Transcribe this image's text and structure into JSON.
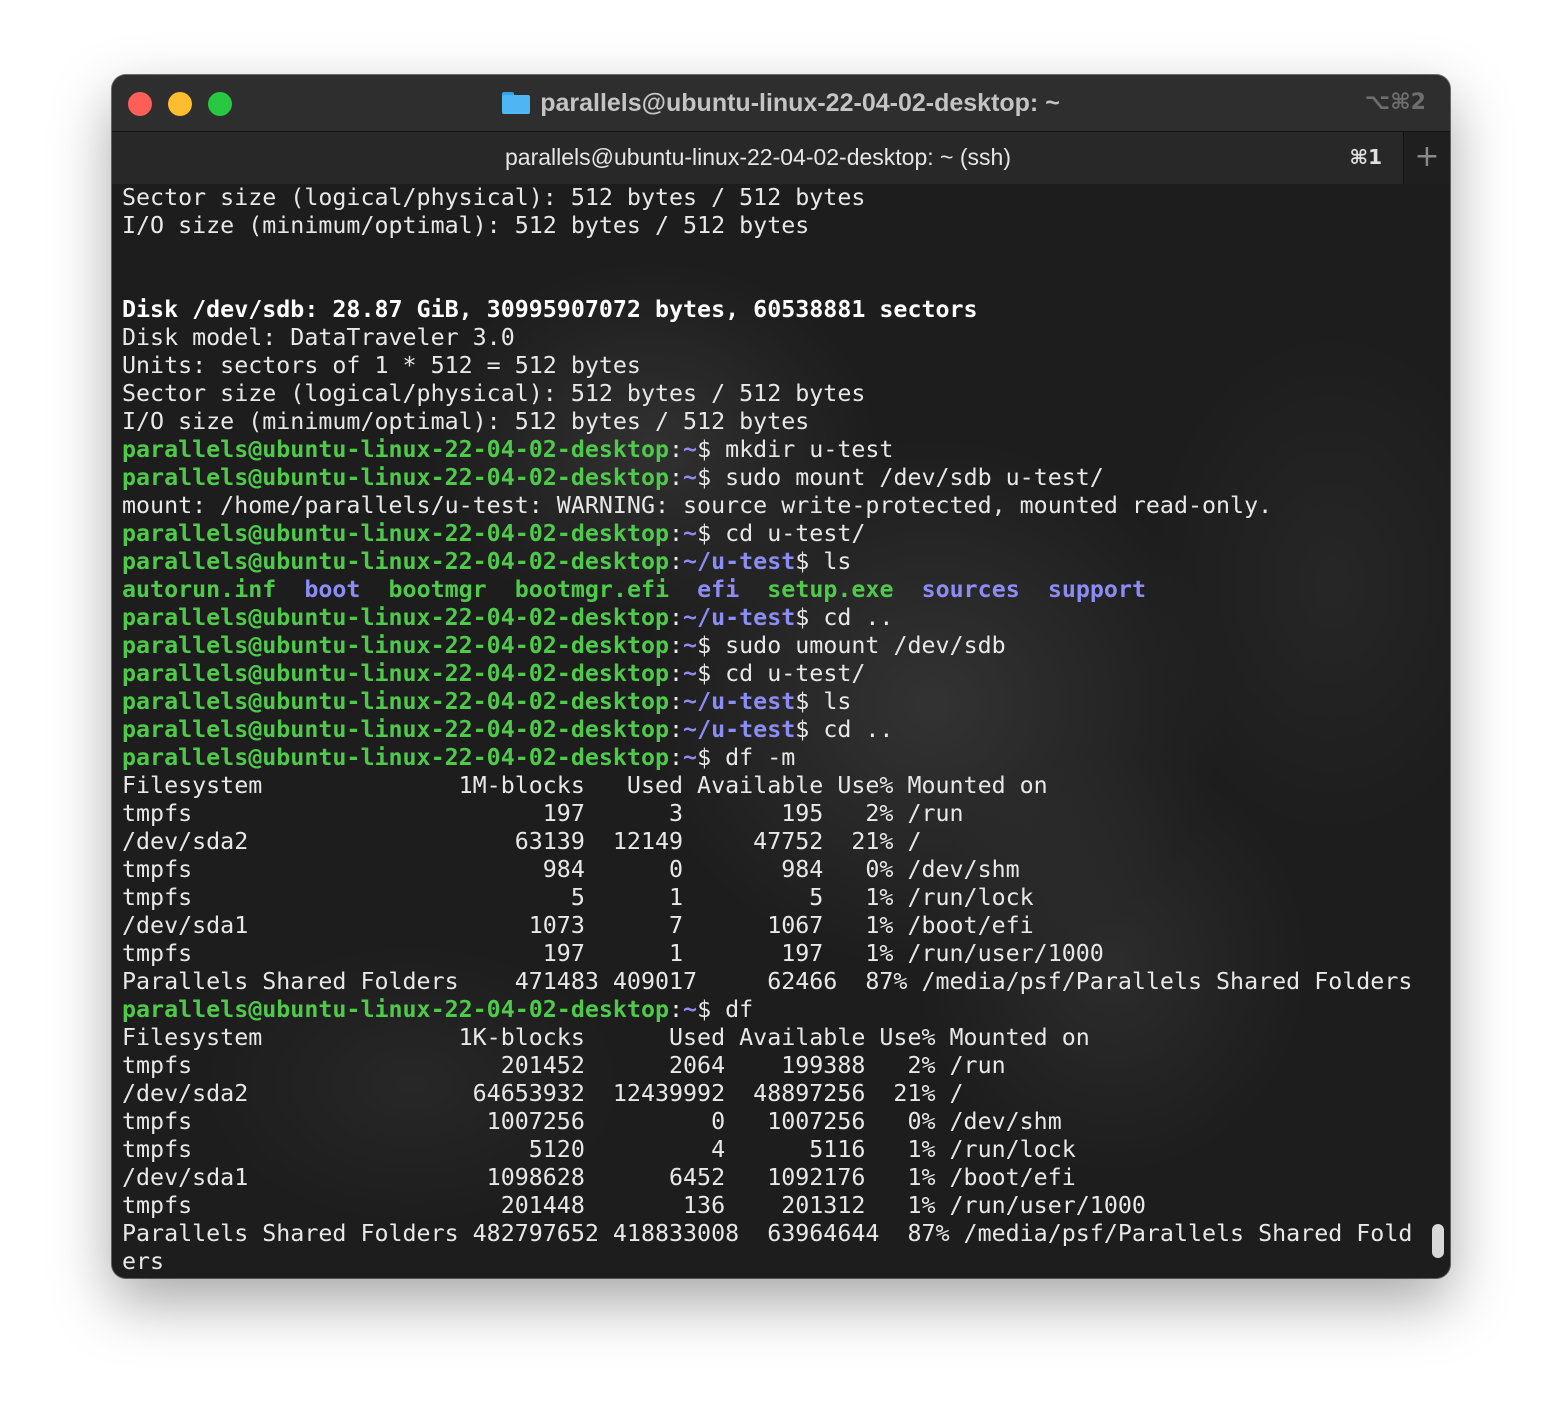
{
  "window": {
    "title": "parallels@ubuntu-linux-22-04-02-desktop: ~",
    "window_shortcut": "⌥⌘2",
    "title_icon": "folder-icon"
  },
  "tab": {
    "label": "parallels@ubuntu-linux-22-04-02-desktop: ~ (ssh)",
    "shortcut": "⌘1",
    "new_tab": "+"
  },
  "prompt": {
    "user_host": "parallels@ubuntu-linux-22-04-02-desktop",
    "colon": ":",
    "home": "~",
    "subdir": "~/u-test",
    "symbol": "$"
  },
  "terminal": {
    "lines": [
      {
        "type": "text",
        "text": "Sector size (logical/physical): 512 bytes / 512 bytes"
      },
      {
        "type": "text",
        "text": "I/O size (minimum/optimal): 512 bytes / 512 bytes"
      },
      {
        "type": "text",
        "text": ""
      },
      {
        "type": "text",
        "text": ""
      },
      {
        "type": "bold",
        "text": "Disk /dev/sdb: 28.87 GiB, 30995907072 bytes, 60538881 sectors"
      },
      {
        "type": "text",
        "text": "Disk model: DataTraveler 3.0"
      },
      {
        "type": "text",
        "text": "Units: sectors of 1 * 512 = 512 bytes"
      },
      {
        "type": "text",
        "text": "Sector size (logical/physical): 512 bytes / 512 bytes"
      },
      {
        "type": "text",
        "text": "I/O size (minimum/optimal): 512 bytes / 512 bytes"
      },
      {
        "type": "prompt",
        "path": "~",
        "cmd": " mkdir u-test"
      },
      {
        "type": "prompt",
        "path": "~",
        "cmd": " sudo mount /dev/sdb u-test/"
      },
      {
        "type": "text",
        "text": "mount: /home/parallels/u-test: WARNING: source write-protected, mounted read-only."
      },
      {
        "type": "prompt",
        "path": "~",
        "cmd": " cd u-test/"
      },
      {
        "type": "prompt",
        "path": "~/u-test",
        "cmd": " ls"
      },
      {
        "type": "ls",
        "items": [
          {
            "name": "autorun.inf",
            "kind": "exe"
          },
          {
            "name": "boot",
            "kind": "dir"
          },
          {
            "name": "bootmgr",
            "kind": "exe"
          },
          {
            "name": "bootmgr.efi",
            "kind": "exe"
          },
          {
            "name": "efi",
            "kind": "dir"
          },
          {
            "name": "setup.exe",
            "kind": "exe"
          },
          {
            "name": "sources",
            "kind": "dir"
          },
          {
            "name": "support",
            "kind": "dir"
          }
        ]
      },
      {
        "type": "prompt",
        "path": "~/u-test",
        "cmd": " cd .."
      },
      {
        "type": "prompt",
        "path": "~",
        "cmd": " sudo umount /dev/sdb"
      },
      {
        "type": "prompt",
        "path": "~",
        "cmd": " cd u-test/"
      },
      {
        "type": "prompt",
        "path": "~/u-test",
        "cmd": " ls"
      },
      {
        "type": "prompt",
        "path": "~/u-test",
        "cmd": " cd .."
      },
      {
        "type": "prompt",
        "path": "~",
        "cmd": " df -m"
      },
      {
        "type": "text",
        "text": "Filesystem              1M-blocks   Used Available Use% Mounted on"
      },
      {
        "type": "text",
        "text": "tmpfs                         197      3       195   2% /run"
      },
      {
        "type": "text",
        "text": "/dev/sda2                   63139  12149     47752  21% /"
      },
      {
        "type": "text",
        "text": "tmpfs                         984      0       984   0% /dev/shm"
      },
      {
        "type": "text",
        "text": "tmpfs                           5      1         5   1% /run/lock"
      },
      {
        "type": "text",
        "text": "/dev/sda1                    1073      7      1067   1% /boot/efi"
      },
      {
        "type": "text",
        "text": "tmpfs                         197      1       197   1% /run/user/1000"
      },
      {
        "type": "text",
        "text": "Parallels Shared Folders    471483 409017     62466  87% /media/psf/Parallels Shared Folders"
      },
      {
        "type": "prompt",
        "path": "~",
        "cmd": " df"
      },
      {
        "type": "text",
        "text": "Filesystem              1K-blocks      Used Available Use% Mounted on"
      },
      {
        "type": "text",
        "text": "tmpfs                      201452      2064    199388   2% /run"
      },
      {
        "type": "text",
        "text": "/dev/sda2                64653932  12439992  48897256  21% /"
      },
      {
        "type": "text",
        "text": "tmpfs                     1007256         0   1007256   0% /dev/shm"
      },
      {
        "type": "text",
        "text": "tmpfs                        5120         4      5116   1% /run/lock"
      },
      {
        "type": "text",
        "text": "/dev/sda1                 1098628      6452   1092176   1% /boot/efi"
      },
      {
        "type": "text",
        "text": "tmpfs                      201448       136    201312   1% /run/user/1000"
      },
      {
        "type": "text",
        "text": "Parallels Shared Folders 482797652 418833008  63964644  87% /media/psf/Parallels Shared Fold"
      },
      {
        "type": "text",
        "text": "ers"
      }
    ]
  },
  "colors": {
    "prompt_user": "#4ec94a",
    "prompt_path": "#8c8cf7",
    "dir": "#8c8cf7",
    "executable": "#4ec94a",
    "text": "#e8e8e8"
  }
}
